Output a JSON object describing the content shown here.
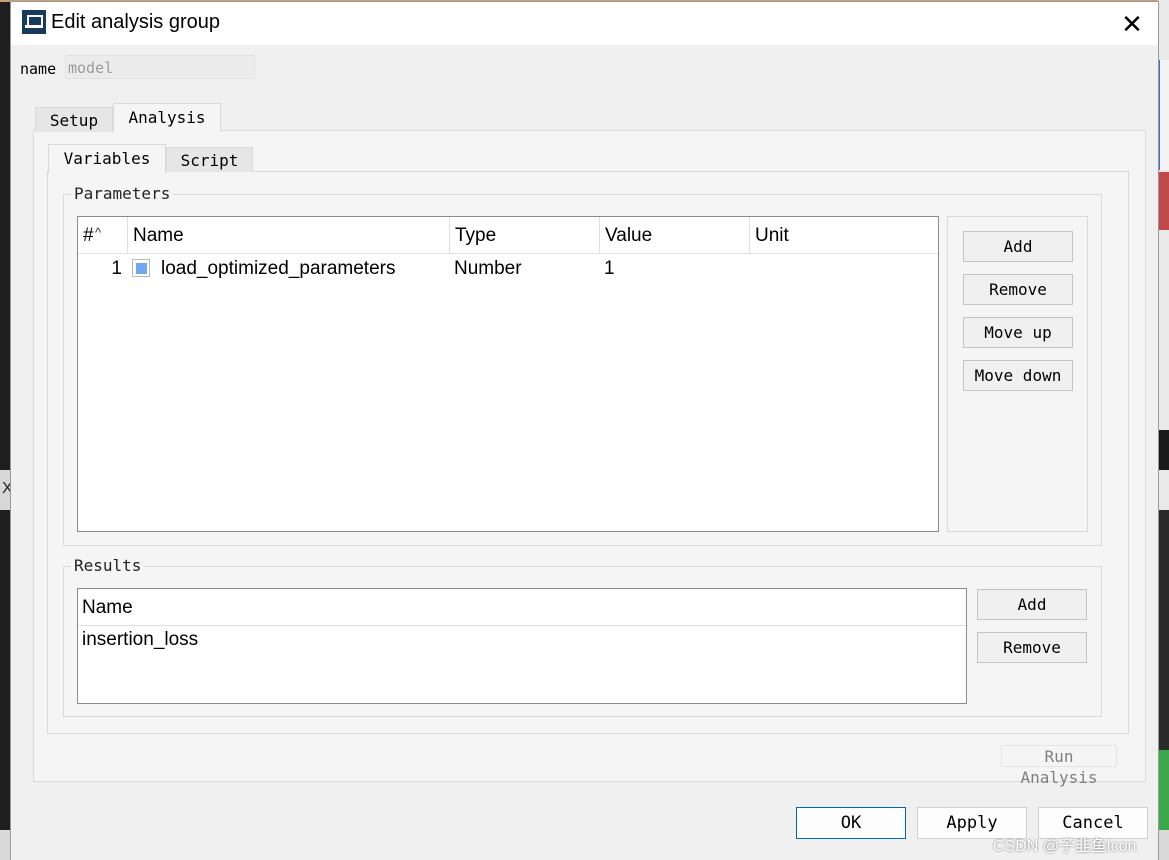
{
  "window": {
    "title": "Edit analysis group",
    "close_glyph": "✕"
  },
  "name_field": {
    "label": "name",
    "value": "model"
  },
  "outer_tabs": [
    {
      "label": "Setup"
    },
    {
      "label": "Analysis"
    }
  ],
  "inner_tabs": [
    {
      "label": "Variables"
    },
    {
      "label": "Script"
    }
  ],
  "parameters": {
    "title": "Parameters",
    "columns": [
      "#",
      "Name",
      "Type",
      "Value",
      "Unit"
    ],
    "rows": [
      {
        "index": "1",
        "name": "load_optimized_parameters",
        "type": "Number",
        "value": "1",
        "unit": ""
      }
    ],
    "buttons": {
      "add": "Add",
      "remove": "Remove",
      "move_up": "Move up",
      "move_down": "Move down"
    }
  },
  "results": {
    "title": "Results",
    "columns": [
      "Name"
    ],
    "rows": [
      {
        "name": "insertion_loss"
      }
    ],
    "buttons": {
      "add": "Add",
      "remove": "Remove"
    }
  },
  "run_analysis": "Run Analysis",
  "footer": {
    "ok": "OK",
    "apply": "Apply",
    "cancel": "Cancel"
  },
  "watermark": "CSDN @子韭鱼icon",
  "icons": {
    "app": "app-logo-icon",
    "close": "close-icon",
    "sort": "sort-ascending-icon",
    "parameter": "parameter-icon"
  },
  "colors": {
    "parameter_icon": "#6fa8f0",
    "ok_border": "#0067c0",
    "title_icon": "#1a3a5c"
  }
}
